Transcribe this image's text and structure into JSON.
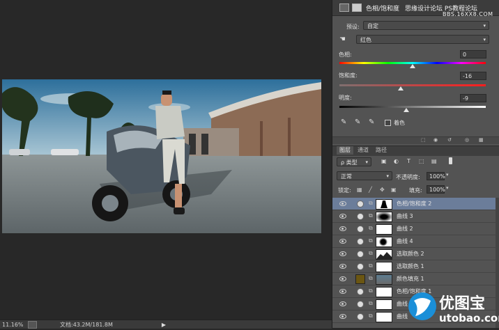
{
  "statusbar": {
    "zoom": "11.16%",
    "doc": "文档:43.2M/181.8M"
  },
  "watermark_top": "思缘设计论坛  PS教程论坛",
  "watermark_top2": "BBS.16XX8.COM",
  "props": {
    "title": "色相/饱和度",
    "preset_label": "预设:",
    "preset_value": "自定",
    "channel_value": "红色",
    "hue_label": "色相:",
    "hue_value": "0",
    "hue_level": 0,
    "sat_label": "饱和度:",
    "sat_value": "-16",
    "sat_level": -16,
    "light_label": "明度:",
    "light_value": "-9",
    "light_level": -9,
    "colorize_label": "着色"
  },
  "layers_panel": {
    "tabs": [
      "图层",
      "通道",
      "路径"
    ],
    "filter_label": "ρ 类型",
    "blend_mode": "正常",
    "opacity_label": "不透明度:",
    "opacity_value": "100%",
    "lock_label": "锁定:",
    "fill_label": "填充:",
    "fill_value": "100%",
    "layers": [
      {
        "name": "色相/饱和度 2",
        "mask": "figure",
        "selected": true
      },
      {
        "name": "曲线 3",
        "mask": "radial"
      },
      {
        "name": "曲线 2",
        "mask": "white"
      },
      {
        "name": "曲线 4",
        "mask": "dark-spot"
      },
      {
        "name": "选取颜色 2",
        "mask": "mountain"
      },
      {
        "name": "选取颜色 1",
        "mask": "white"
      },
      {
        "name": "颜色填充 1",
        "mask": "photo",
        "swatch": "#6b5612"
      },
      {
        "name": "色相/饱和度 1",
        "mask": "white"
      },
      {
        "name": "曲线 1",
        "mask": "white"
      },
      {
        "name": "曲线",
        "mask": "white"
      }
    ]
  },
  "logo": {
    "text": "优图宝",
    "url": "utobao.com"
  }
}
